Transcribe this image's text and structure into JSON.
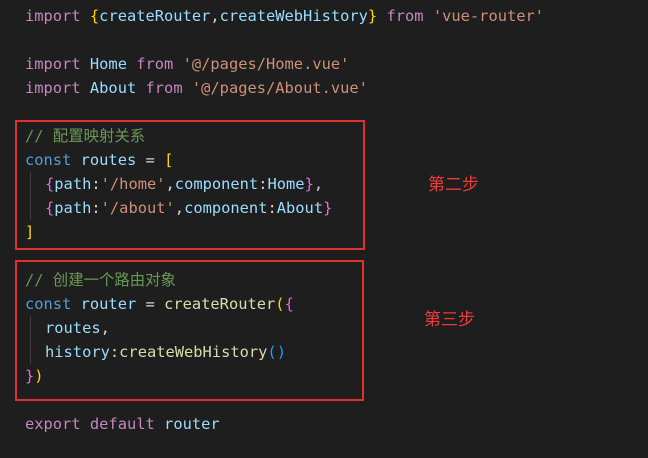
{
  "code": {
    "l1": {
      "kw_import": "import",
      "brace_open": "{",
      "name1": "createRouter",
      "comma": ",",
      "name2": "createWebHistory",
      "brace_close": "}",
      "kw_from": "from",
      "str": "'vue-router'"
    },
    "l2": {
      "kw_import": "import",
      "name": "Home",
      "kw_from": "from",
      "str": "'@/pages/Home.vue'"
    },
    "l3": {
      "kw_import": "import",
      "name": "About",
      "kw_from": "from",
      "str": "'@/pages/About.vue'"
    },
    "l4": {
      "comment": "// 配置映射关系"
    },
    "l5": {
      "kw_const": "const",
      "name": "routes",
      "eq": "=",
      "bracket": "["
    },
    "l6": {
      "brace_open": "{",
      "key_path": "path",
      "colon1": ":",
      "str": "'/home'",
      "comma1": ",",
      "key_component": "component",
      "colon2": ":",
      "value": "Home",
      "brace_close": "}",
      "comma2": ","
    },
    "l7": {
      "brace_open": "{",
      "key_path": "path",
      "colon1": ":",
      "str": "'/about'",
      "comma1": ",",
      "key_component": "component",
      "colon2": ":",
      "value": "About",
      "brace_close": "}"
    },
    "l8": {
      "bracket": "]"
    },
    "l9": {
      "comment": "// 创建一个路由对象"
    },
    "l10": {
      "kw_const": "const",
      "name": "router",
      "eq": "=",
      "fn": "createRouter",
      "paren": "(",
      "brace": "{"
    },
    "l11": {
      "name": "routes",
      "comma": ","
    },
    "l12": {
      "key": "history",
      "colon": ":",
      "fn": "createWebHistory",
      "paren_open": "(",
      "paren_close": ")"
    },
    "l13": {
      "brace": "}",
      "paren": ")"
    },
    "l14": {
      "kw_export": "export",
      "kw_default": "default",
      "name": "router"
    }
  },
  "annotations": {
    "step2": "第二步",
    "step3": "第三步"
  },
  "colors": {
    "background": "#1e1e1e",
    "keyword": "#c586c0",
    "string": "#ce9178",
    "variable": "#9cdcfe",
    "const": "#569cd6",
    "function": "#dcdcaa",
    "comment": "#6a9955",
    "bracket1": "#ffd700",
    "bracket2": "#da70d6",
    "bracket3": "#179fff",
    "highlight_box": "#e03131",
    "annotation_text": "#f03a3a"
  }
}
